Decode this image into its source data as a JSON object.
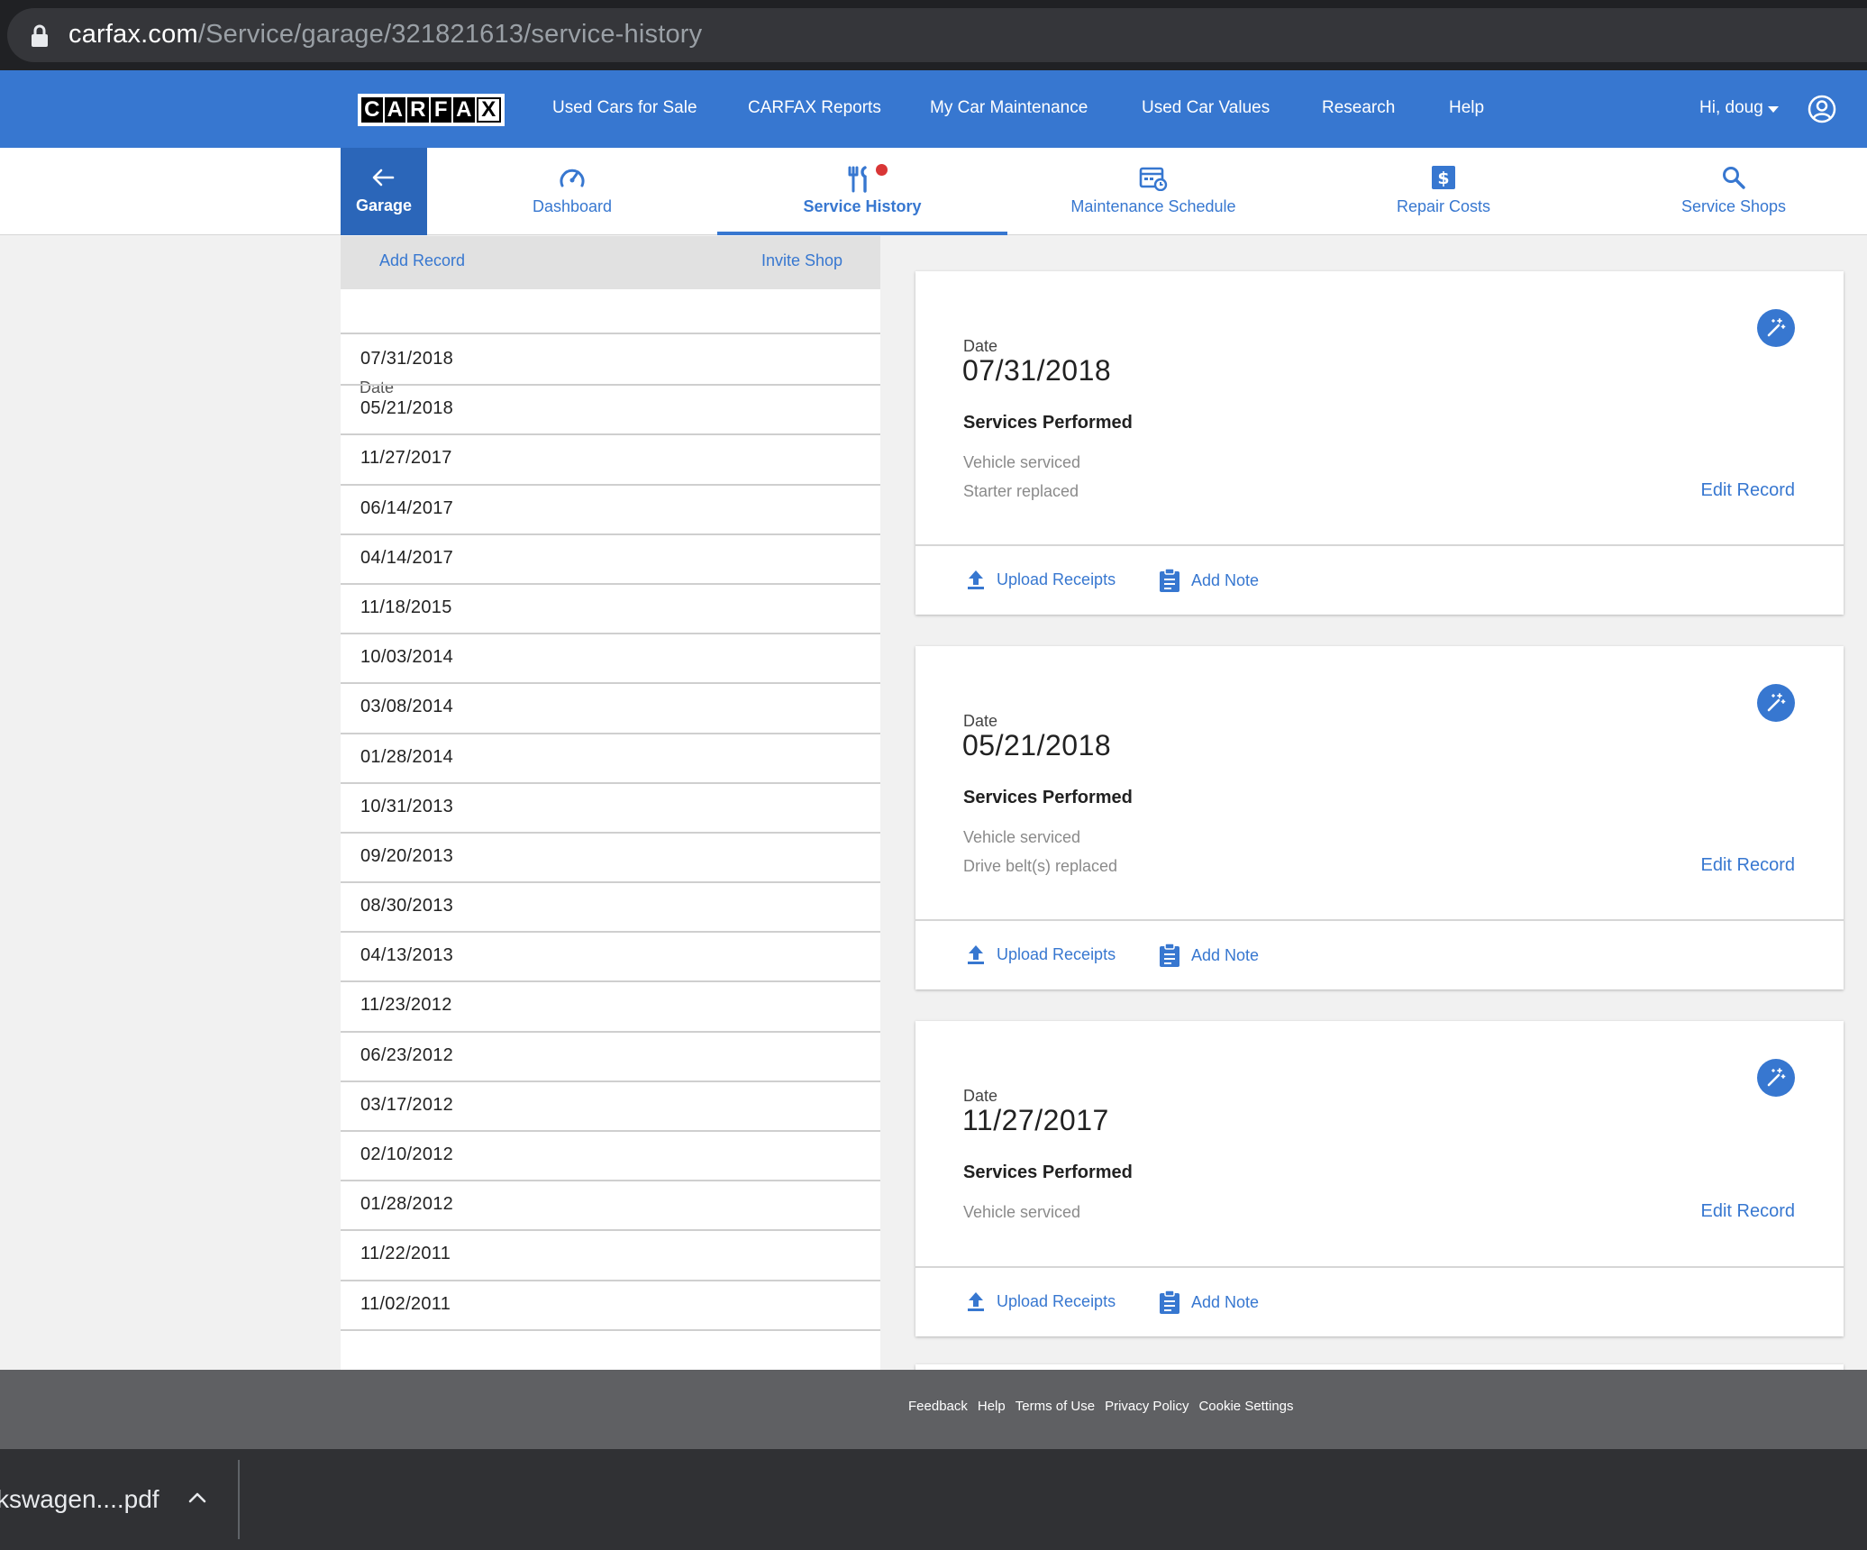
{
  "browser": {
    "url_host": "carfax.com",
    "url_path": "/Service/garage/321821613/service-history"
  },
  "topnav": {
    "logo_letters": [
      "C",
      "A",
      "R",
      "F",
      "A",
      "X"
    ],
    "links": [
      "Used Cars for Sale",
      "CARFAX Reports",
      "My Car Maintenance",
      "Used Car Values",
      "Research",
      "Help"
    ],
    "greeting": "Hi, doug"
  },
  "subnav": {
    "garage": "Garage",
    "tabs": [
      {
        "label": "Dashboard",
        "icon": "speedometer-icon"
      },
      {
        "label": "Service History",
        "icon": "wrench-tools-icon",
        "active": true
      },
      {
        "label": "Maintenance Schedule",
        "icon": "calendar-clock-icon"
      },
      {
        "label": "Repair Costs",
        "icon": "dollar-icon"
      },
      {
        "label": "Service Shops",
        "icon": "search-icon"
      }
    ]
  },
  "list": {
    "add_record": "Add Record",
    "invite_shop": "Invite Shop",
    "date_header": "Date",
    "dates": [
      "07/31/2018",
      "05/21/2018",
      "11/27/2017",
      "06/14/2017",
      "04/14/2017",
      "11/18/2015",
      "10/03/2014",
      "03/08/2014",
      "01/28/2014",
      "10/31/2013",
      "09/20/2013",
      "08/30/2013",
      "04/13/2013",
      "11/23/2012",
      "06/23/2012",
      "03/17/2012",
      "02/10/2012",
      "01/28/2012",
      "11/22/2011",
      "11/02/2011"
    ]
  },
  "records": [
    {
      "date_label": "Date",
      "date": "07/31/2018",
      "services_title": "Services Performed",
      "services": [
        "Vehicle serviced",
        "Starter replaced"
      ],
      "edit": "Edit Record",
      "upload": "Upload Receipts",
      "note": "Add Note"
    },
    {
      "date_label": "Date",
      "date": "05/21/2018",
      "services_title": "Services Performed",
      "services": [
        "Vehicle serviced",
        "Drive belt(s) replaced"
      ],
      "edit": "Edit Record",
      "upload": "Upload Receipts",
      "note": "Add Note"
    },
    {
      "date_label": "Date",
      "date": "11/27/2017",
      "services_title": "Services Performed",
      "services": [
        "Vehicle serviced"
      ],
      "edit": "Edit Record",
      "upload": "Upload Receipts",
      "note": "Add Note"
    }
  ],
  "footer": {
    "links": [
      "Feedback",
      "Help",
      "Terms of Use",
      "Privacy Policy",
      "Cookie Settings"
    ]
  },
  "download_shelf": {
    "filename": "kswagen....pdf"
  },
  "colors": {
    "brand_blue": "#3777d0",
    "garage_blue": "#2b66b9",
    "notification_red": "#d93636"
  }
}
